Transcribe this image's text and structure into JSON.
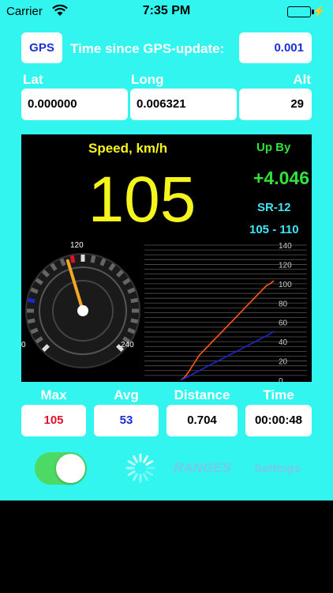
{
  "status_bar": {
    "carrier": "Carrier",
    "time": "7:35 PM"
  },
  "gps": {
    "button_label": "GPS",
    "update_label": "Time since GPS-update:",
    "update_value": "0.001"
  },
  "position": {
    "lat_label": "Lat",
    "lat_value": "0.000000",
    "long_label": "Long",
    "long_value": "0.006321",
    "alt_label": "Alt",
    "alt_value": "29"
  },
  "speed": {
    "title": "Speed, km/h",
    "value": "105",
    "upby_label": "Up By",
    "upby_value": "+4.046",
    "route": "SR-12",
    "range": "105 - 110"
  },
  "gauge": {
    "label_min": "0",
    "label_mid": "120",
    "label_max": "240",
    "value": 105,
    "max": 240
  },
  "chart_data": {
    "type": "line",
    "y_ticks": [
      "140",
      "120",
      "100",
      "80",
      "60",
      "40",
      "20",
      "0"
    ],
    "ylim": [
      0,
      140
    ],
    "series": [
      {
        "values": [
          0,
          3,
          8,
          14,
          20,
          26,
          30,
          34,
          38,
          42,
          46,
          50,
          54,
          58,
          62,
          66,
          70,
          74,
          78,
          82,
          86,
          90,
          94,
          98,
          100,
          103
        ]
      },
      {
        "values": [
          0,
          2,
          4,
          6,
          8,
          10,
          12,
          14,
          16,
          18,
          20,
          22,
          24,
          26,
          28,
          30,
          32,
          34,
          36,
          38,
          40,
          42,
          44,
          46,
          48,
          51
        ]
      }
    ],
    "colors": [
      "#ff5a14",
      "#2027c8"
    ]
  },
  "stats": {
    "max_label": "Max",
    "max_value": "105",
    "avg_label": "Avg",
    "avg_value": "53",
    "distance_label": "Distance",
    "distance_value": "0.704",
    "time_label": "Time",
    "time_value": "00:00:48"
  },
  "controls": {
    "toggle_on": true,
    "ranges_label": "RANGES",
    "settings_label": "Settings"
  },
  "colors": {
    "background": "#33f5f0",
    "speed": "#f5f51e",
    "upby": "#32e13a",
    "accent_blue": "#1a2fd6",
    "max_red": "#e0102a",
    "toggle_green": "#4cd964"
  }
}
